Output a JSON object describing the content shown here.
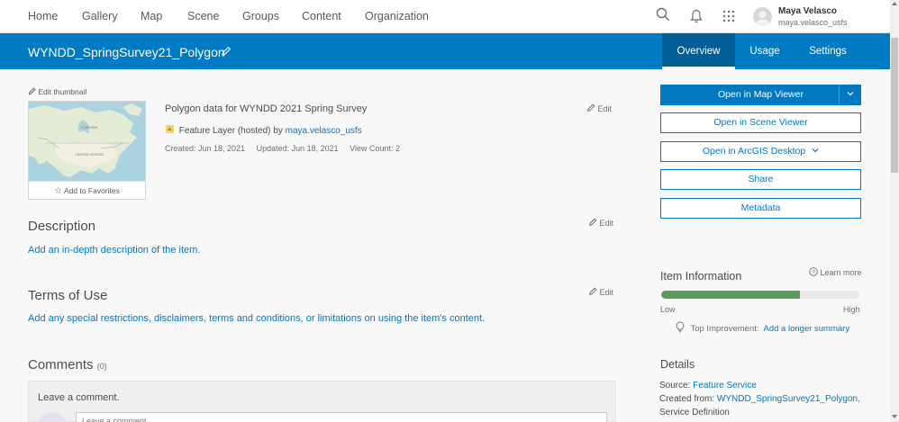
{
  "nav": {
    "items": [
      "Home",
      "Gallery",
      "Map",
      "Scene",
      "Groups",
      "Content",
      "Organization"
    ],
    "icons": [
      "search-icon",
      "bell-icon",
      "app-launcher-icon"
    ],
    "user_name": "Maya Velasco",
    "user_handle": "maya.velasco_usfs"
  },
  "title_bar": {
    "title": "WYNDD_SpringSurvey21_Polygon",
    "tabs": [
      "Overview",
      "Usage",
      "Settings"
    ],
    "active_tab": "Overview"
  },
  "item": {
    "edit_thumbnail": "Edit thumbnail",
    "add_to_favorites": "Add to Favorites",
    "summary": "Polygon data for WYNDD 2021 Spring Survey",
    "type_label": "Feature Layer (hosted) by ",
    "owner": "maya.velasco_usfs",
    "created": "Created: Jun 18, 2021",
    "updated": "Updated: Jun 18, 2021",
    "view_count": "View Count: 2",
    "edit_label": "Edit"
  },
  "description": {
    "heading": "Description",
    "link": "Add an in-depth description of the item."
  },
  "terms": {
    "heading": "Terms of Use",
    "link": "Add any special restrictions, disclaimers, terms and conditions, or limitations on using the item's content."
  },
  "comments": {
    "heading": "Comments",
    "count": "(0)",
    "leave": "Leave a comment.",
    "placeholder": "Leave a comment"
  },
  "actions": {
    "open_map_viewer": "Open in Map Viewer",
    "open_scene_viewer": "Open in Scene Viewer",
    "open_arcgis_desktop": "Open in ArcGIS Desktop",
    "share": "Share",
    "metadata": "Metadata"
  },
  "item_info": {
    "heading": "Item Information",
    "learn_more": "Learn more",
    "low": "Low",
    "high": "High",
    "progress_fraction": 0.7,
    "top_improvement_label": "Top Improvement:",
    "top_improvement_link": "Add a longer summary",
    "meter_color": "#5a9b5a"
  },
  "details": {
    "heading": "Details",
    "source_label": "Source: ",
    "source_value": "Feature Service",
    "created_from_label": "Created from: ",
    "created_from_value": "WYNDD_SpringSurvey21_Polygon,",
    "service_def": "Service Definition"
  },
  "colors": {
    "brand_blue": "#007ac2",
    "link": "#0079c1"
  }
}
